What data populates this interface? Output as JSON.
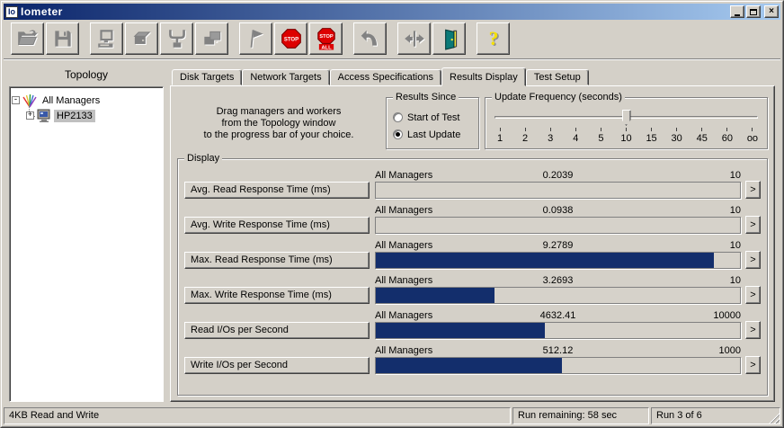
{
  "window": {
    "title": "Iometer",
    "icon_text": "Io"
  },
  "toolbar": {
    "buttons": [
      {
        "name": "open-test-config",
        "icon": "open-folder-icon",
        "enabled": false
      },
      {
        "name": "save-test-config",
        "icon": "save-floppy-icon",
        "enabled": false
      },
      {
        "name": "start-new-manager",
        "icon": "computer-icon",
        "enabled": false
      },
      {
        "name": "start-disk-worker",
        "icon": "disk-worker-icon",
        "enabled": false
      },
      {
        "name": "start-network-worker",
        "icon": "network-worker-icon",
        "enabled": false
      },
      {
        "name": "duplicate-worker",
        "icon": "duplicate-icon",
        "enabled": false
      },
      {
        "name": "start-tests",
        "icon": "flag-icon",
        "enabled": false
      },
      {
        "name": "stop-test",
        "icon": "stop-sign-icon",
        "enabled": true
      },
      {
        "name": "stop-all-tests",
        "icon": "stop-all-sign-icon",
        "enabled": true
      },
      {
        "name": "reset-workers",
        "icon": "undo-arrow-icon",
        "enabled": false
      },
      {
        "name": "disconnect",
        "icon": "inward-arrows-icon",
        "enabled": false
      },
      {
        "name": "exit",
        "icon": "exit-door-icon",
        "enabled": true
      },
      {
        "name": "about",
        "icon": "question-mark-icon",
        "enabled": true
      }
    ]
  },
  "topology": {
    "title": "Topology",
    "nodes": [
      {
        "label": "All Managers",
        "expander": "-",
        "icon": "managers-fan-icon",
        "selected": false
      },
      {
        "label": "HP2133",
        "expander": "+",
        "icon": "computer-node-icon",
        "selected": true
      }
    ]
  },
  "tabs": {
    "labels": [
      "Disk Targets",
      "Network Targets",
      "Access Specifications",
      "Results Display",
      "Test Setup"
    ],
    "active": "Results Display"
  },
  "results_display": {
    "drag_hint_lines": [
      "Drag managers and workers",
      "from the Topology window",
      "to the progress bar of your choice."
    ],
    "results_since": {
      "label": "Results Since",
      "options": [
        {
          "label": "Start of Test",
          "selected": false
        },
        {
          "label": "Last Update",
          "selected": true
        }
      ]
    },
    "update_frequency": {
      "label": "Update Frequency (seconds)",
      "tick_labels": [
        "1",
        "2",
        "3",
        "4",
        "5",
        "10",
        "15",
        "30",
        "45",
        "60",
        "oo"
      ],
      "selected_tick": "10"
    },
    "display": {
      "label": "Display",
      "expand_button_glyph": ">",
      "rows": [
        {
          "metric": "Avg. Read Response Time (ms)",
          "scope": "All Managers",
          "value": "0.2039",
          "max": "10",
          "fill_pct": 0
        },
        {
          "metric": "Avg. Write Response Time (ms)",
          "scope": "All Managers",
          "value": "0.0938",
          "max": "10",
          "fill_pct": 0
        },
        {
          "metric": "Max. Read Response Time (ms)",
          "scope": "All Managers",
          "value": "9.2789",
          "max": "10",
          "fill_pct": 92.8
        },
        {
          "metric": "Max. Write Response Time (ms)",
          "scope": "All Managers",
          "value": "3.2693",
          "max": "10",
          "fill_pct": 32.7
        },
        {
          "metric": "Read I/Os per Second",
          "scope": "All Managers",
          "value": "4632.41",
          "max": "10000",
          "fill_pct": 46.3
        },
        {
          "metric": "Write I/Os per Second",
          "scope": "All Managers",
          "value": "512.12",
          "max": "1000",
          "fill_pct": 51.2
        }
      ]
    }
  },
  "statusbar": {
    "left": "4KB Read and Write",
    "middle": "Run remaining: 58 sec",
    "right": "Run 3 of 6"
  },
  "colors": {
    "chrome": "#d4d0c8",
    "bar_fill": "#132e6c",
    "titlebar_left": "#0a246a",
    "titlebar_right": "#a6caf0",
    "stop_red": "#dd0000"
  }
}
